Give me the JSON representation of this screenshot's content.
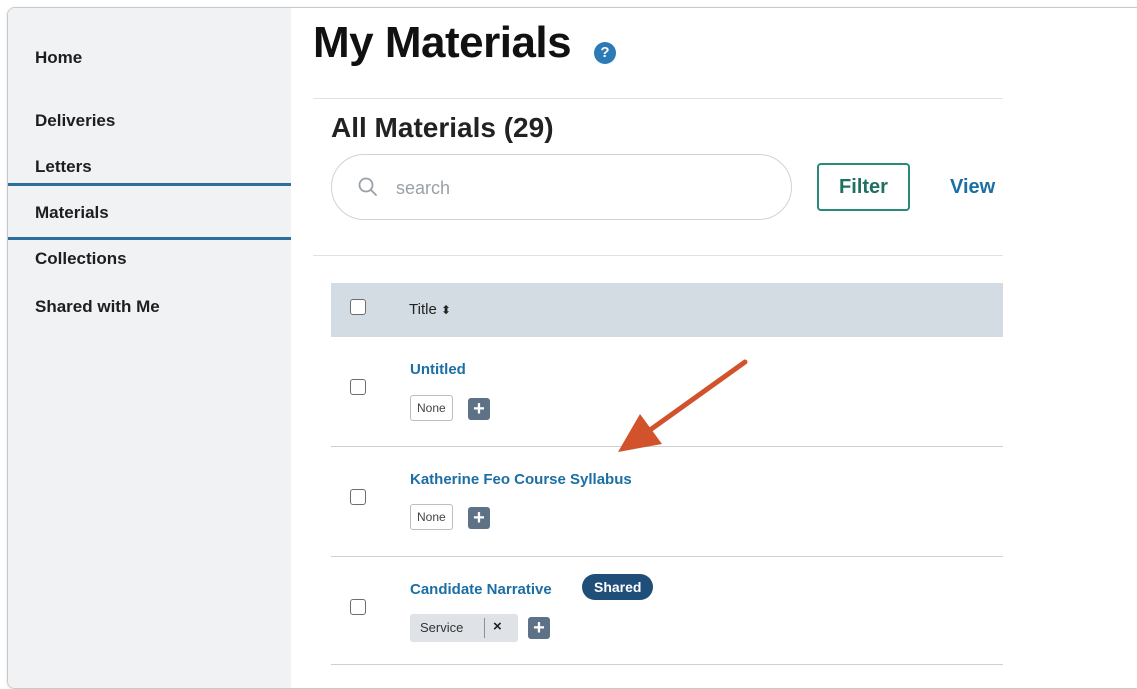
{
  "sidebar": {
    "items": [
      {
        "label": "Home"
      },
      {
        "label": "Deliveries"
      },
      {
        "label": "Letters"
      },
      {
        "label": "Materials",
        "active": true
      },
      {
        "label": "Collections"
      },
      {
        "label": "Shared with Me"
      }
    ]
  },
  "header": {
    "title": "My Materials",
    "help_icon": "?"
  },
  "main": {
    "section_title": "All Materials (29)",
    "search": {
      "placeholder": "search",
      "value": ""
    },
    "filter_label": "Filter",
    "view_label": "View"
  },
  "table": {
    "column_title": "Title",
    "sort_icon": "⬍",
    "rows": [
      {
        "title": "Untitled",
        "tag": "None",
        "checked": false
      },
      {
        "title": "Katherine Feo Course Syllabus",
        "tag": "None",
        "checked": false
      },
      {
        "title": "Candidate Narrative",
        "badge": "Shared",
        "tag": "Service",
        "remove": "×",
        "checked": false
      }
    ]
  },
  "icons": {
    "plus": "+",
    "search_icon": "search-icon",
    "annotation_arrow": "arrow-annotation"
  },
  "colors": {
    "sidebar_bg": "#f1f2f4",
    "sidebar_rule": "#2b6f9a",
    "link": "#1c6ea4",
    "filter": "#2a8a7a",
    "badge": "#1f4e79",
    "table_header": "#d3dce3",
    "arrow": "#d2522c"
  }
}
